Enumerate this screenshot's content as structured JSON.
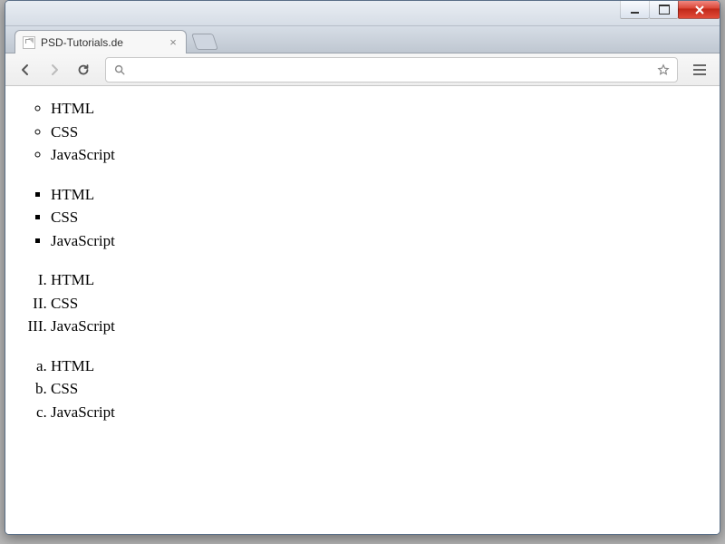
{
  "tab": {
    "title": "PSD-Tutorials.de"
  },
  "address": {
    "value": ""
  },
  "lists": [
    {
      "style": "circle",
      "type": "ul",
      "items": [
        "HTML",
        "CSS",
        "JavaScript"
      ]
    },
    {
      "style": "square",
      "type": "ul",
      "items": [
        "HTML",
        "CSS",
        "JavaScript"
      ]
    },
    {
      "style": "upper-roman",
      "type": "ol",
      "items": [
        "HTML",
        "CSS",
        "JavaScript"
      ]
    },
    {
      "style": "lower-alpha",
      "type": "ol",
      "items": [
        "HTML",
        "CSS",
        "JavaScript"
      ]
    }
  ]
}
